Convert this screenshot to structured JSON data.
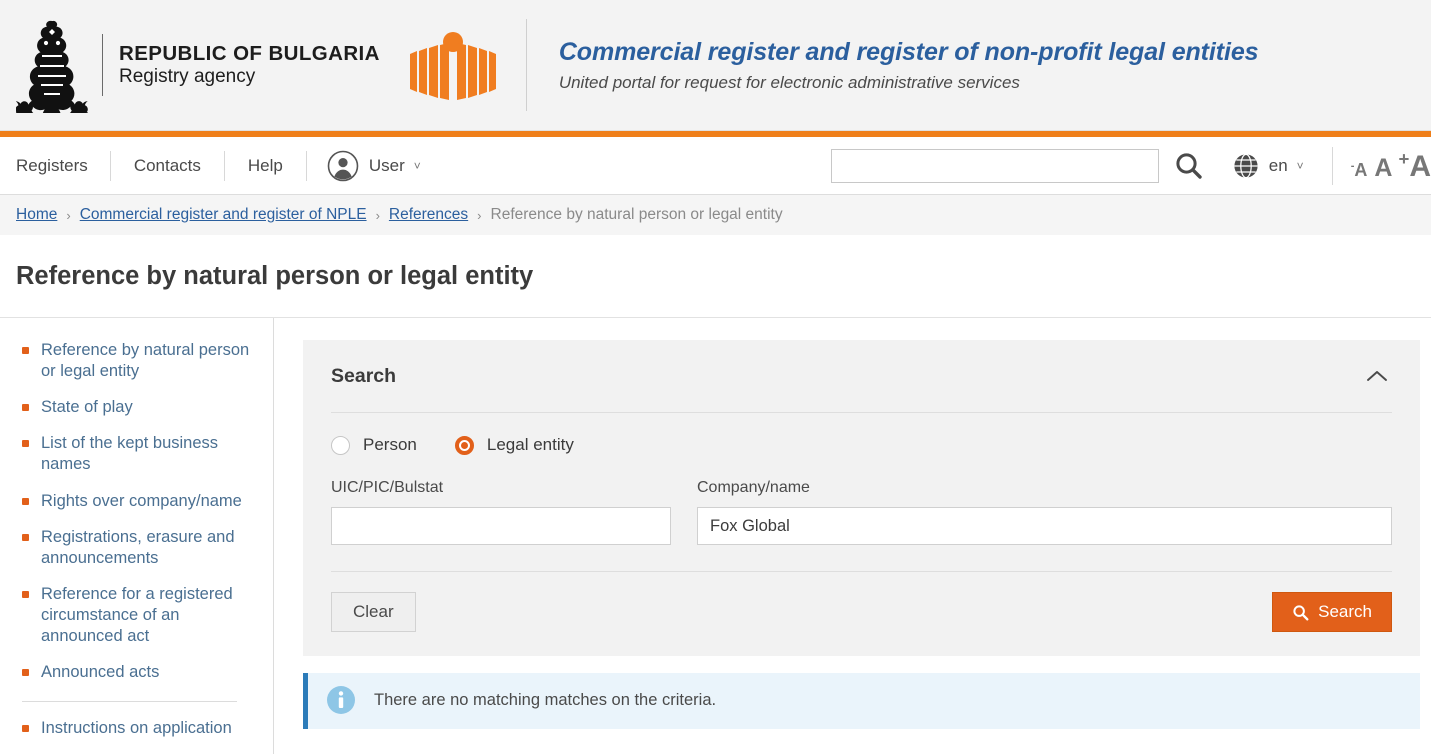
{
  "header": {
    "emblem_icon": "bulgaria-coat-of-arms",
    "brand_line1": "REPUBLIC OF BULGARIA",
    "brand_line2": "Registry agency",
    "registry_mark_icon": "registry-agency-logo",
    "title": "Commercial register and register of non-profit legal entities",
    "subtitle": "United portal for request for electronic administrative services",
    "accent_color": "#ef7f1a",
    "title_color": "#2b5f9e"
  },
  "nav": {
    "items": [
      {
        "label": "Registers"
      },
      {
        "label": "Contacts"
      },
      {
        "label": "Help"
      }
    ],
    "user": {
      "icon": "user-avatar-icon",
      "label": "User",
      "caret": "˅"
    },
    "search": {
      "value": "",
      "placeholder": "",
      "icon": "search-icon"
    },
    "language": {
      "icon": "globe-icon",
      "label": "en",
      "caret": "˅"
    },
    "font_size": {
      "decrease": "A",
      "decrease_sign": "-",
      "normal": "A",
      "increase": "A",
      "increase_sign": "+"
    }
  },
  "breadcrumb": {
    "separator": "›",
    "items": [
      {
        "label": "Home",
        "current": false
      },
      {
        "label": "Commercial register and register of NPLE",
        "current": false
      },
      {
        "label": "References",
        "current": false
      },
      {
        "label": "Reference by natural person or legal entity",
        "current": true
      }
    ]
  },
  "page": {
    "title": "Reference by natural person or legal entity"
  },
  "sidebar": {
    "items": [
      {
        "label": "Reference by natural person or legal entity"
      },
      {
        "label": "State of play"
      },
      {
        "label": "List of the kept business names"
      },
      {
        "label": "Rights over company/name"
      },
      {
        "label": "Registrations, erasure and announcements"
      },
      {
        "label": "Reference for a registered circumstance of an announced act"
      },
      {
        "label": "Announced acts"
      }
    ],
    "items_after_divider": [
      {
        "label": "Instructions on application"
      }
    ]
  },
  "search_panel": {
    "title": "Search",
    "collapse_icon": "chevron-up-icon",
    "radio": {
      "options": [
        {
          "label": "Person",
          "checked": false
        },
        {
          "label": "Legal entity",
          "checked": true
        }
      ]
    },
    "fields": {
      "uic": {
        "label": "UIC/PIC/Bulstat",
        "value": "",
        "placeholder": ""
      },
      "company": {
        "label": "Company/name",
        "value": "Fox Global",
        "placeholder": ""
      }
    },
    "buttons": {
      "clear": "Clear",
      "search": "Search",
      "search_icon": "search-icon"
    },
    "accent_color": "#e2601a"
  },
  "message": {
    "icon": "info-icon",
    "text": "There are no matching matches on the criteria.",
    "accent_color": "#2b7bb9"
  }
}
